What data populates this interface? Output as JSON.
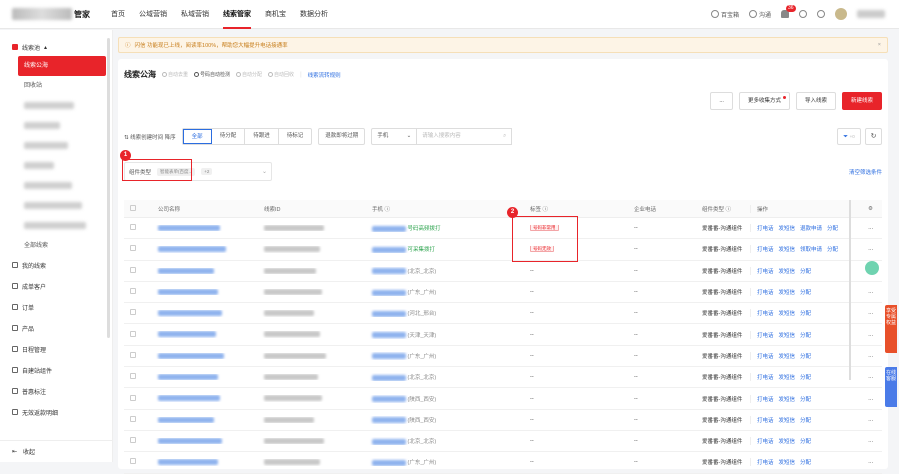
{
  "topbar": {
    "logo_text": "管家",
    "nav": [
      {
        "label": "首页",
        "active": false
      },
      {
        "label": "公域营销",
        "active": false
      },
      {
        "label": "私域营销",
        "active": false
      },
      {
        "label": "线索管家",
        "active": true
      },
      {
        "label": "商机宝",
        "active": false
      },
      {
        "label": "数据分析",
        "active": false
      }
    ],
    "right_links": [
      "百宝箱",
      "沟通"
    ],
    "notification_count": "36"
  },
  "sidebar": {
    "group_title": "线索池",
    "items": [
      "线索公海",
      "回收站"
    ],
    "all_leads": "全部线索",
    "groups": [
      "我的线索",
      "成单客户",
      "订单",
      "产品",
      "日程管理",
      "自建站组件",
      "普惠标注",
      "无效返款明细"
    ],
    "collapse": "收起"
  },
  "notice": {
    "text": "闪信 功能现已上线，阅读率100%，帮助您大幅提升电话接通率",
    "close": "×"
  },
  "panel": {
    "title": "线索公海",
    "options": [
      {
        "label": "自动去重",
        "on": false
      },
      {
        "label": "号码自动检测",
        "on": true
      },
      {
        "label": "自动分配",
        "on": false
      },
      {
        "label": "自动回收",
        "on": false
      }
    ],
    "rules_link": "线索流转规则",
    "actions": [
      "...",
      "更多收集方式",
      "导入线索",
      "新建线索"
    ]
  },
  "filters": {
    "sort_label": "线索创建时间 降序",
    "segments": [
      "全部",
      "待分配",
      "待跟进",
      "待标记"
    ],
    "expired_btn": "退款即将过期",
    "search_type": "手机",
    "search_placeholder": "请输入搜索内容",
    "filter_count": "+0"
  },
  "conditions": {
    "label": "组件类型",
    "chip1": "智能表单(百度...",
    "chip2": "+2",
    "clear": "清空筛选条件"
  },
  "markers": [
    "1",
    "2"
  ],
  "table": {
    "headers": [
      "公司名称",
      "线索ID",
      "手机",
      "标签",
      "企业电话",
      "组件类型",
      "操作"
    ],
    "rows": [
      {
        "phone_tag": "号码高频拨打",
        "tag": "号码非常用",
        "ent": "--",
        "comp": "爱番番-沟通组件",
        "acts": [
          "打电话",
          "发短信",
          "退款申请",
          "分配"
        ]
      },
      {
        "phone_tag": "可采集拨打",
        "tag": "号码无效",
        "ent": "--",
        "comp": "爱番番-沟通组件",
        "acts": [
          "打电话",
          "发短信",
          "领取申请",
          "分配"
        ]
      },
      {
        "phone_tag": "(北京_北京)",
        "tag": "--",
        "ent": "--",
        "comp": "爱番番-沟通组件",
        "acts": [
          "打电话",
          "发短信",
          "分配"
        ]
      },
      {
        "phone_tag": "(广东_广州)",
        "tag": "--",
        "ent": "--",
        "comp": "爱番番-沟通组件",
        "acts": [
          "打电话",
          "发短信",
          "分配"
        ]
      },
      {
        "phone_tag": "(河北_邢台)",
        "tag": "--",
        "ent": "--",
        "comp": "爱番番-沟通组件",
        "acts": [
          "打电话",
          "发短信",
          "分配"
        ]
      },
      {
        "phone_tag": "(天津_天津)",
        "tag": "--",
        "ent": "--",
        "comp": "爱番番-沟通组件",
        "acts": [
          "打电话",
          "发短信",
          "分配"
        ]
      },
      {
        "phone_tag": "(广东_广州)",
        "tag": "--",
        "ent": "--",
        "comp": "爱番番-沟通组件",
        "acts": [
          "打电话",
          "发短信",
          "分配"
        ]
      },
      {
        "phone_tag": "(北京_北京)",
        "tag": "--",
        "ent": "--",
        "comp": "爱番番-沟通组件",
        "acts": [
          "打电话",
          "发短信",
          "分配"
        ]
      },
      {
        "phone_tag": "(陕西_西安)",
        "tag": "--",
        "ent": "--",
        "comp": "爱番番-沟通组件",
        "acts": [
          "打电话",
          "发短信",
          "分配"
        ]
      },
      {
        "phone_tag": "(陕西_西安)",
        "tag": "--",
        "ent": "--",
        "comp": "爱番番-沟通组件",
        "acts": [
          "打电话",
          "发短信",
          "分配"
        ]
      },
      {
        "phone_tag": "(北京_北京)",
        "tag": "--",
        "ent": "--",
        "comp": "爱番番-沟通组件",
        "acts": [
          "打电话",
          "发短信",
          "分配"
        ]
      },
      {
        "phone_tag": "(广东_广州)",
        "tag": "--",
        "ent": "--",
        "comp": "爱番番-沟通组件",
        "acts": [
          "打电话",
          "发短信",
          "分配"
        ]
      }
    ]
  },
  "side_tabs": [
    "享受专属权益",
    "在线客服"
  ]
}
